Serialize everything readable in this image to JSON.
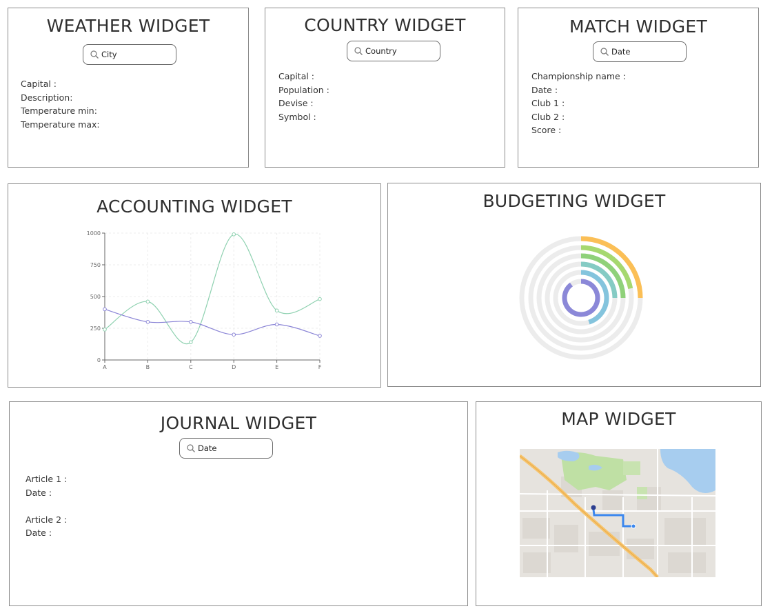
{
  "weather": {
    "title": "WEATHER WIDGET",
    "search_placeholder": "City",
    "fields": [
      "Capital :",
      "Description:",
      "Temperature min:",
      "Temperature max:"
    ]
  },
  "country": {
    "title": "COUNTRY WIDGET",
    "search_placeholder": "Country",
    "fields": [
      "Capital :",
      "Population :",
      "Devise :",
      "Symbol :"
    ]
  },
  "match": {
    "title": "MATCH WIDGET",
    "search_placeholder": "Date",
    "fields": [
      "Championship name :",
      "Date :",
      "Club 1 :",
      "Club 2 :",
      "Score :"
    ]
  },
  "accounting": {
    "title": "ACCOUNTING WIDGET"
  },
  "budgeting": {
    "title": "BUDGETING WIDGET"
  },
  "journal": {
    "title": "JOURNAL WIDGET",
    "search_placeholder": "Date",
    "article1": [
      "Article 1 :",
      "Date :"
    ],
    "article2": [
      "Article 2 :",
      "Date :"
    ]
  },
  "map": {
    "title": "MAP WIDGET"
  },
  "chart_data": [
    {
      "type": "line",
      "x": [
        "A",
        "B",
        "C",
        "D",
        "E",
        "F"
      ],
      "y_ticks": [
        0,
        250,
        500,
        750,
        1000
      ],
      "ylim": [
        0,
        1000
      ],
      "grid": true,
      "series": [
        {
          "values": [
            240,
            460,
            140,
            990,
            390,
            480
          ],
          "color": "#8ed1b0"
        },
        {
          "values": [
            400,
            300,
            300,
            200,
            280,
            190
          ],
          "color": "#8a84d6"
        }
      ]
    },
    {
      "type": "radial-bar",
      "rings": [
        {
          "fraction": 0.25,
          "color": "#fbbf56"
        },
        {
          "fraction": 0.22,
          "color": "#a6d86f"
        },
        {
          "fraction": 0.25,
          "color": "#8fd17a"
        },
        {
          "fraction": 0.25,
          "color": "#85cbc4"
        },
        {
          "fraction": 0.45,
          "color": "#84c4dd"
        },
        {
          "fraction": 0.9,
          "color": "#8b88d8"
        }
      ],
      "track_color": "#ececec"
    }
  ]
}
